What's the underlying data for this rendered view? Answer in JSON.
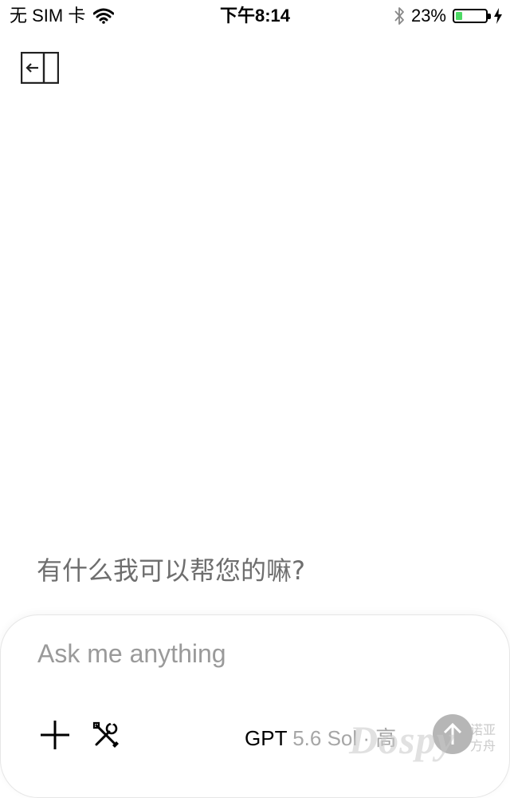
{
  "status_bar": {
    "carrier": "无 SIM 卡",
    "time": "下午8:14",
    "battery_percent_text": "23%",
    "battery_level": 0.23,
    "wifi_icon": "wifi-icon",
    "bluetooth_icon": "bluetooth-icon",
    "charging_icon": "lightning-icon"
  },
  "header": {
    "sidebar_toggle_icon": "sidebar-toggle-icon"
  },
  "main": {
    "greeting": "有什么我可以帮您的嘛?"
  },
  "composer": {
    "placeholder": "Ask me anything",
    "value": "",
    "plus_icon": "plus-icon",
    "tools_icon": "tools-icon",
    "model_name": "GPT",
    "model_variant": "5.6 Sol · 高",
    "send_icon": "arrow-up-icon"
  },
  "watermark": {
    "text": "Dospy",
    "text_cn": "诺亚方舟"
  },
  "colors": {
    "battery_fill": "#4cd964",
    "greeting_text": "#6e6e6e",
    "placeholder": "#9a9a9a",
    "send_button": "#9e9e9e"
  }
}
